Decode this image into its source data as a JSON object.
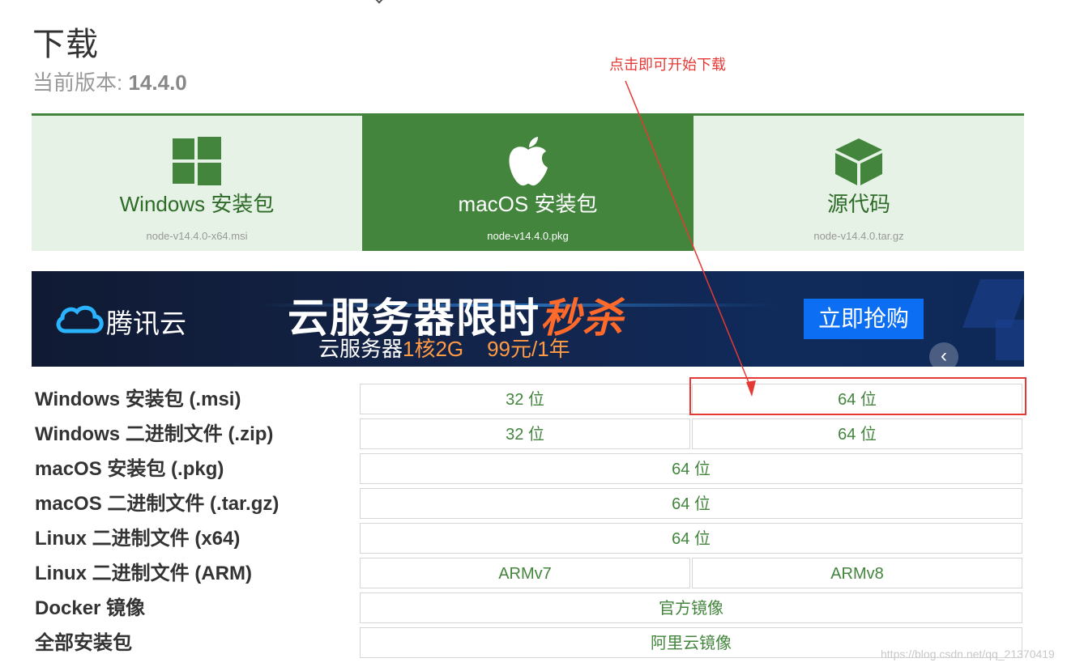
{
  "page": {
    "title": "下载",
    "version_label": "当前版本:",
    "version_value": "14.4.0"
  },
  "tabs": [
    {
      "label": "Windows 安装包",
      "file": "node-v14.4.0-x64.msi",
      "icon": "windows-logo-icon",
      "active": false
    },
    {
      "label": "macOS 安装包",
      "file": "node-v14.4.0.pkg",
      "icon": "apple-logo-icon",
      "active": true
    },
    {
      "label": "源代码",
      "file": "node-v14.4.0.tar.gz",
      "icon": "cube-icon",
      "active": false
    }
  ],
  "banner": {
    "brand": "腾讯云",
    "headline_main": "云服务器限时",
    "headline_hot": "秒杀",
    "sub_main": "云服务器",
    "sub_spec": "1核2G",
    "sub_price": "99元/1年",
    "cta": "立即抢购"
  },
  "downloads": [
    {
      "name": "Windows 安装包 (.msi)",
      "options": [
        "32 位",
        "64 位"
      ]
    },
    {
      "name": "Windows 二进制文件 (.zip)",
      "options": [
        "32 位",
        "64 位"
      ]
    },
    {
      "name": "macOS 安装包 (.pkg)",
      "options": [
        "64 位"
      ]
    },
    {
      "name": "macOS 二进制文件 (.tar.gz)",
      "options": [
        "64 位"
      ]
    },
    {
      "name": "Linux 二进制文件 (x64)",
      "options": [
        "64 位"
      ]
    },
    {
      "name": "Linux 二进制文件 (ARM)",
      "options": [
        "ARMv7",
        "ARMv8"
      ]
    },
    {
      "name": "Docker 镜像",
      "options": [
        "官方镜像"
      ]
    },
    {
      "name": "全部安装包",
      "options": [
        "阿里云镜像"
      ]
    }
  ],
  "annotation": {
    "text": "点击即可开始下载",
    "color": "#e53935"
  },
  "watermark": "https://blog.csdn.net/qq_21370419",
  "colors": {
    "brand_green": "#43853d",
    "tab_bg": "#e6f2e5",
    "annotation_red": "#e53935",
    "banner_button": "#0c6ef2"
  }
}
